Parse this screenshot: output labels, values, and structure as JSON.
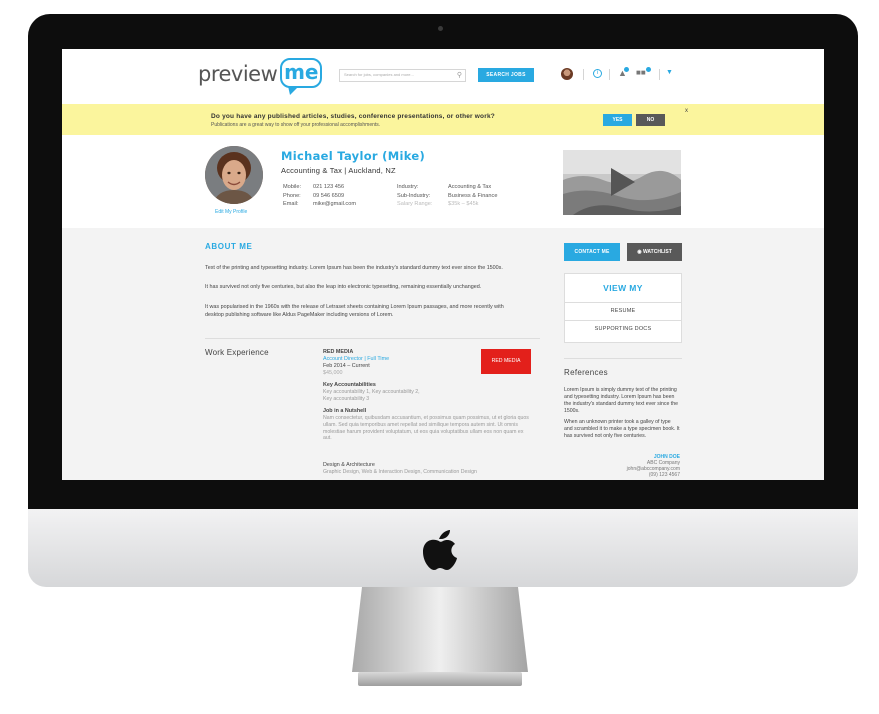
{
  "brand": {
    "logo_text": "preview",
    "logo_accent": "me",
    "accent_color": "#29a9e1"
  },
  "header": {
    "search_placeholder": "Search for jobs, companies and more...",
    "search_button": "SEARCH JOBS"
  },
  "banner": {
    "question": "Do you have any published articles, studies, conference presentations, or other work?",
    "subtext": "Publications are a great way to show off your professional accomplishments.",
    "yes_label": "YES",
    "no_label": "NO",
    "close_label": "x"
  },
  "profile": {
    "name": "Michael Taylor (Mike)",
    "role_location": "Accounting & Tax |  Auckland, NZ",
    "edit_photo": "Edit My Profile",
    "contact": [
      {
        "label": "Mobile:",
        "value": "021 123 456"
      },
      {
        "label": "Phone:",
        "value": "09 546 6509"
      },
      {
        "label": "Email:",
        "value": "mike@gmail.com"
      }
    ],
    "industry": [
      {
        "label": "Industry:",
        "value": "Accounting & Tax"
      },
      {
        "label": "Sub-Industry:",
        "value": "Business & Finance"
      },
      {
        "label": "Salary Range:",
        "value": "$35k – $45k"
      }
    ]
  },
  "about": {
    "title": "ABOUT ME",
    "paragraphs": [
      "Text of the printing and typesetting industry. Lorem Ipsum has been the industry's standard dummy text ever since the 1500s.",
      "It has survived not only five centuries, but also the leap into electronic typesetting, remaining essentially unchanged.",
      "It was popularised in the 1960s with the release of Letraset sheets containing Lorem Ipsum passages, and more recently with desktop publishing software like Aldus PageMaker including versions of Lorem."
    ]
  },
  "work": {
    "title": "Work Experience",
    "company": "RED MEDIA",
    "position": "Account Director | Full Time",
    "dates": "Feb 2014 – Current",
    "salary": "$45,000",
    "logo_label": "RED MEDIA",
    "accountabilities_title": "Key Accountabilities",
    "accountabilities": [
      "Key accountability 1, Key accountability 2,",
      "Key accountability 3"
    ],
    "nutshell_title": "Job in a Nutshell",
    "nutshell": "Nam consectetur, quibusdam accusantium, et possimus quam possimus, ut et gloria quos ullam. Sed quia temporibus amet repellat sed similique tempora autem sint. Ut omnis molestiae harum provident voluptatum, ut eos quia voluptatibus ullam eos non quam ex aut.",
    "skills_title": "Design & Architecture",
    "skills": "Graphic Design, Web & Interaction Design, Communication Design"
  },
  "sidebar": {
    "contact_button": "CONTACT ME",
    "watchlist_button": "WATCHLIST",
    "viewmy_title": "VIEW MY",
    "viewmy_items": [
      "RESUME",
      "SUPPORTING DOCS"
    ],
    "references_title": "References",
    "ref_paragraphs": [
      "Lorem Ipsum is simply dummy text of the printing and typesetting industry. Lorem Ipsum has been the industry's standard dummy text ever since the 1500s.",
      "When an unknown printer took a galley of type and scrambled it to make a type specimen book. It has survived not only five centuries."
    ],
    "ref_name": "JOHN DOE",
    "ref_company": "ABC Company",
    "ref_email": "john@abccompany.com",
    "ref_phone": "(09) 123 4567"
  }
}
